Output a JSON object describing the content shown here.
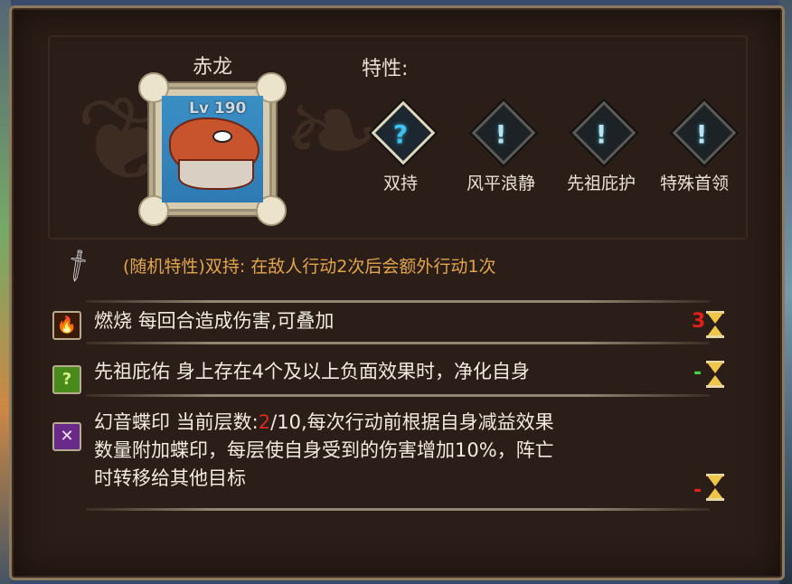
{
  "character": {
    "name": "赤龙",
    "level_label": "Lv 190"
  },
  "traits": {
    "title": "特性:",
    "items": [
      {
        "label": "双持",
        "glyph": "?",
        "icon": "question-diamond-icon",
        "active": true
      },
      {
        "label": "风平浪静",
        "glyph": "!",
        "icon": "exclamation-diamond-icon",
        "active": false
      },
      {
        "label": "先祖庇护",
        "glyph": "!",
        "icon": "exclamation-diamond-icon",
        "active": false
      },
      {
        "label": "特殊首领",
        "glyph": "!",
        "icon": "exclamation-diamond-icon",
        "active": false
      }
    ]
  },
  "trait_description": {
    "icon": "sword-icon",
    "text": "(随机特性)双持: 在敌人行动2次后会额外行动1次"
  },
  "effects": [
    {
      "icon": "fire-icon",
      "glyph": "🔥",
      "icon_bg": "#3a1a08",
      "name": "燃烧",
      "desc": "每回合造成伤害,可叠加",
      "turns": "3",
      "turns_color": "#e0201a"
    },
    {
      "icon": "question-icon",
      "glyph": "?",
      "icon_bg": "#4a8a1a",
      "name": "先祖庇佑",
      "desc": "身上存在4个及以上负面效果时，净化自身",
      "turns": "-",
      "turns_color": "#4ad04a"
    },
    {
      "icon": "butterfly-seal-icon",
      "glyph": "✕",
      "icon_bg": "#6a2a8a",
      "name": "幻音蝶印",
      "desc_prefix": "当前层数:",
      "stack_current": "2",
      "stack_current_color": "#e02a1a",
      "desc_line1_rest": "/10,每次行动前根据自身减益效果",
      "desc_line2": "数量附加蝶印，每层使自身受到的伤害增加10%，阵亡",
      "desc_line3": "时转移给其他目标",
      "turns": "-",
      "turns_color": "#e0201a"
    }
  ]
}
